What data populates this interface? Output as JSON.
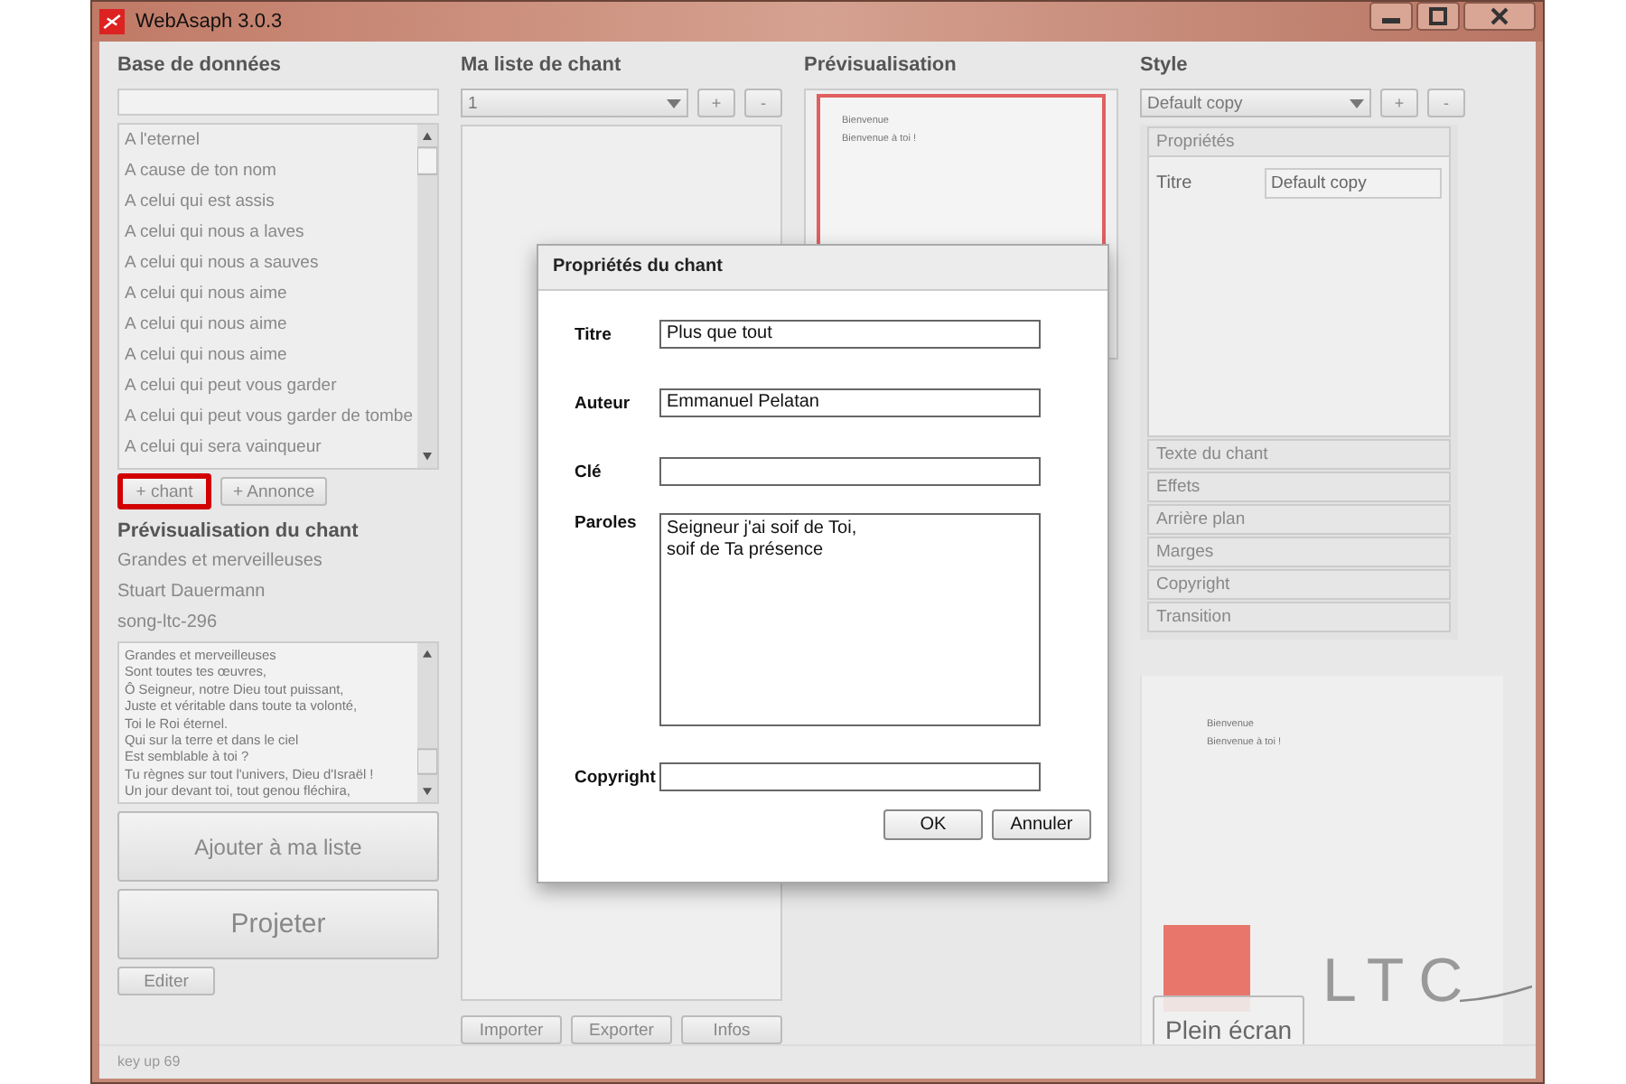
{
  "window": {
    "title": "WebAsaph 3.0.3"
  },
  "database": {
    "title": "Base de données",
    "songs": [
      "A l'eternel",
      "A cause de ton nom",
      "A celui qui est assis",
      "A celui qui nous a laves",
      "A celui qui nous a sauves",
      "A celui qui nous aime",
      "A celui qui nous aime",
      "A celui qui nous aime",
      "A celui qui peut vous garder",
      "A celui qui peut vous garder de tombe",
      "A celui qui sera vainqueur"
    ],
    "buttons": [
      {
        "label": "+ chant",
        "highlighted": true
      },
      {
        "label": "+ Annonce",
        "highlighted": false
      }
    ]
  },
  "song_preview": {
    "title": "Prévisualisation du chant",
    "song_title": "Grandes et merveilleuses",
    "author": "Stuart Dauermann",
    "code": "song-ltc-296",
    "lyrics": [
      "Grandes et merveilleuses",
      "Sont toutes tes œuvres,",
      "Ô Seigneur, notre Dieu tout puissant,",
      "Juste et véritable dans toute ta volonté,",
      "Toi le Roi éternel.",
      "Qui sur la terre et dans le ciel",
      "Est semblable à toi ?",
      "Tu règnes sur tout l'univers, Dieu d'Israël !",
      "Un jour devant toi, tout genou fléchira,"
    ],
    "add_button": "Ajouter à ma liste",
    "project_button": "Projeter",
    "edit_button": "Editer"
  },
  "playlist": {
    "title": "Ma liste de chant",
    "selector": "1",
    "buttons": [
      "+",
      "-"
    ],
    "footer_buttons": [
      "Importer",
      "Exporter",
      "Infos"
    ]
  },
  "preview": {
    "title": "Prévisualisation",
    "slide_lines": [
      "Bienvenue",
      "Bienvenue à toi !"
    ]
  },
  "style": {
    "title": "Style",
    "selector": "Default copy",
    "buttons": [
      "+",
      "-"
    ],
    "sections": [
      {
        "label": "Propriétés",
        "expanded": true
      },
      {
        "label": "Texte du chant",
        "expanded": false
      },
      {
        "label": "Effets",
        "expanded": false
      },
      {
        "label": "Arrière plan",
        "expanded": false
      },
      {
        "label": "Marges",
        "expanded": false
      },
      {
        "label": "Copyright",
        "expanded": false
      },
      {
        "label": "Transition",
        "expanded": false
      }
    ],
    "property": {
      "label": "Titre",
      "value": "Default copy"
    }
  },
  "output_preview": {
    "lines": [
      "Bienvenue",
      "Bienvenue à toi !"
    ],
    "fullscreen_button": "Plein écran",
    "logo_text": "LTC"
  },
  "status_bar": "key up 69",
  "dialog": {
    "title": "Propriétés du chant",
    "fields": [
      {
        "label": "Titre",
        "value": "Plus que tout",
        "kind": "line"
      },
      {
        "label": "Auteur",
        "value": "Emmanuel Pelatan",
        "kind": "line"
      },
      {
        "label": "Clé",
        "kind": "line"
      },
      {
        "label": "Paroles",
        "value": "Seigneur j'ai soif de Toi,\nsoif de Ta présence",
        "kind": "area"
      },
      {
        "label": "Copyright",
        "kind": "line"
      }
    ],
    "buttons": [
      "OK",
      "Annuler"
    ]
  }
}
